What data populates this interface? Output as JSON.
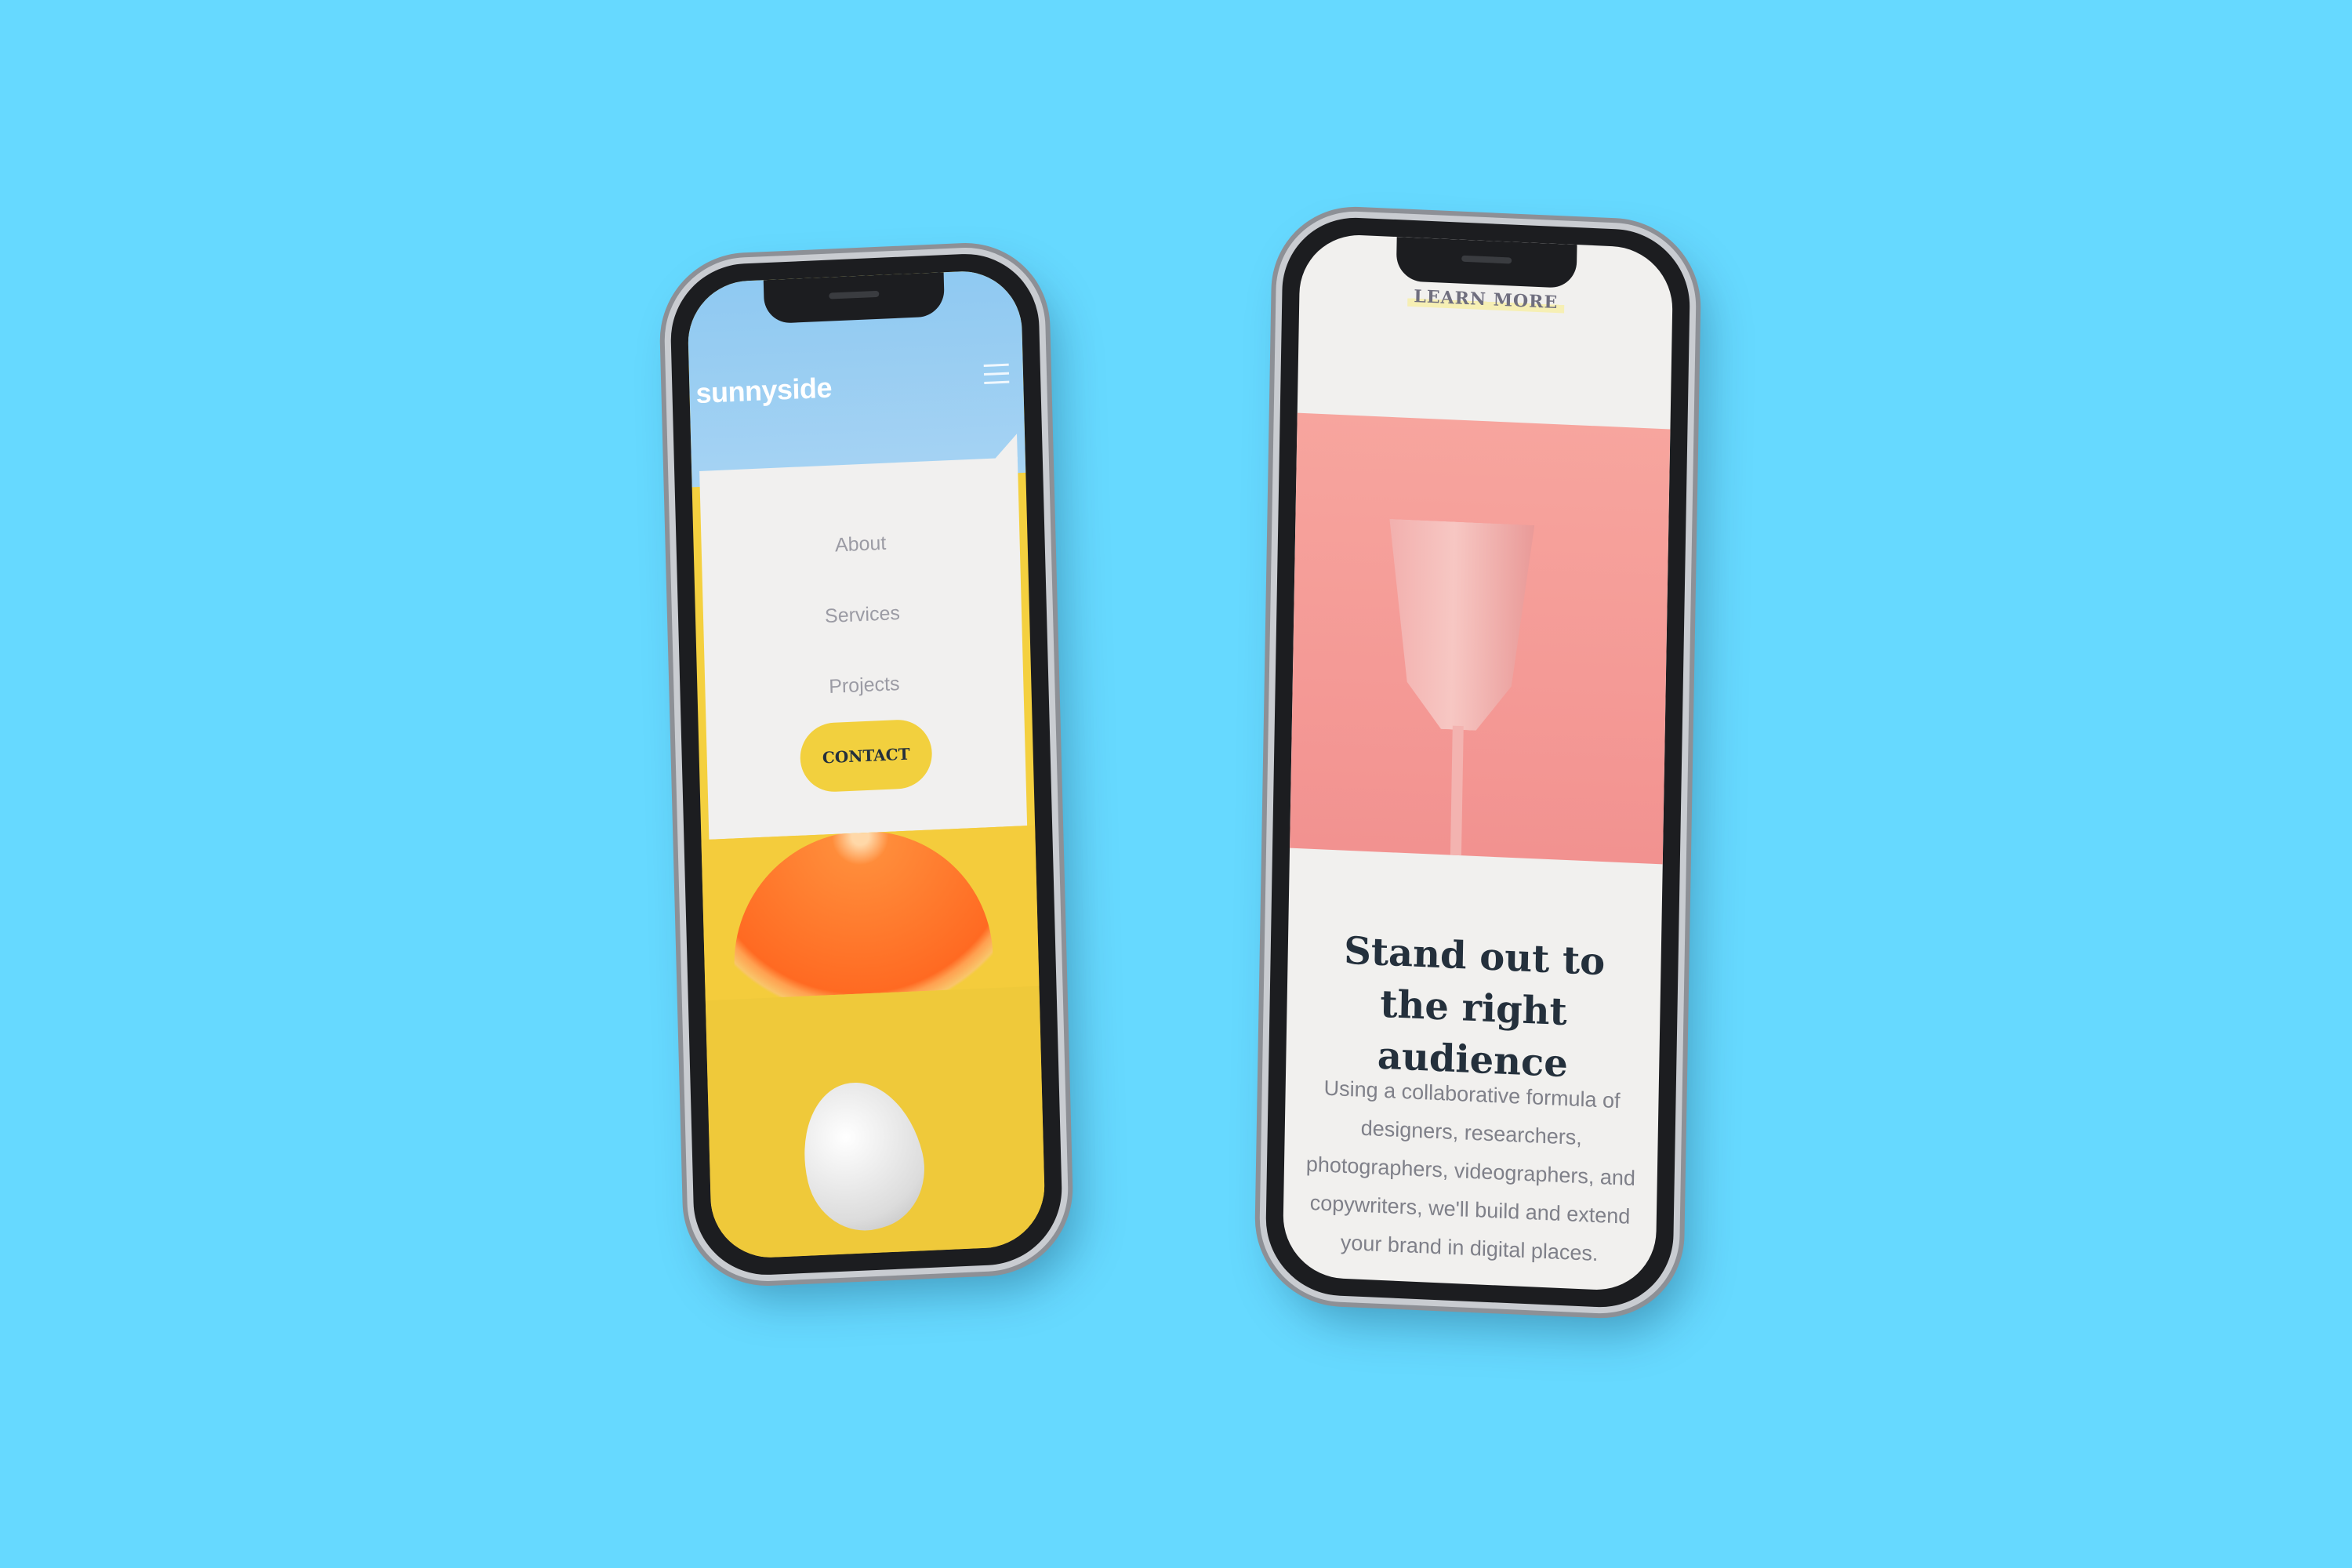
{
  "colors": {
    "background": "#66d9ff",
    "accent_yellow": "#f2d03e",
    "dark_text": "#24303c",
    "muted_text": "#9b9ba4"
  },
  "left_phone": {
    "logo": "sunnyside",
    "menu_icon": "hamburger-icon",
    "menu": {
      "items": [
        "About",
        "Services",
        "Projects"
      ],
      "cta": "CONTACT"
    }
  },
  "right_phone": {
    "link": "LEARN MORE",
    "headline": "Stand out to the right audience",
    "body": "Using a collaborative formula of designers, researchers, photographers, videographers, and copywriters, we'll build and extend your brand in digital places."
  }
}
